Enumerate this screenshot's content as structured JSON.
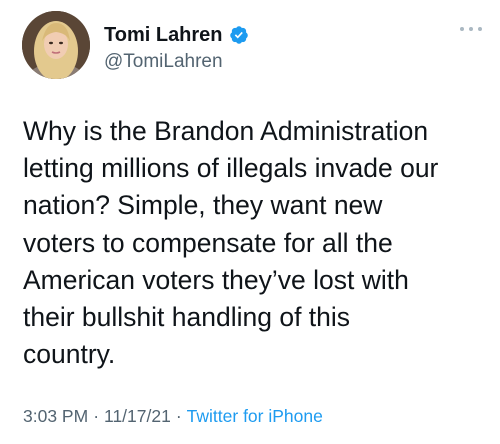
{
  "author": {
    "display_name": "Tomi Lahren",
    "handle": "@TomiLahren",
    "verified": true,
    "verified_color": "#1d9bf0",
    "avatar_icon": "profile-photo"
  },
  "tweet": {
    "lines": [
      "Why is the Brandon Administration",
      "letting millions of illegals invade our",
      "nation? Simple, they want new",
      "voters to compensate for all the",
      "American voters they’ve lost with",
      "their bullshit handling of this",
      "country."
    ]
  },
  "meta": {
    "time": "3:03 PM",
    "separator": "·",
    "date": "11/17/21",
    "source": "Twitter for iPhone",
    "source_color": "#1d9bf0"
  },
  "more_icon": "more-horizontal-icon"
}
